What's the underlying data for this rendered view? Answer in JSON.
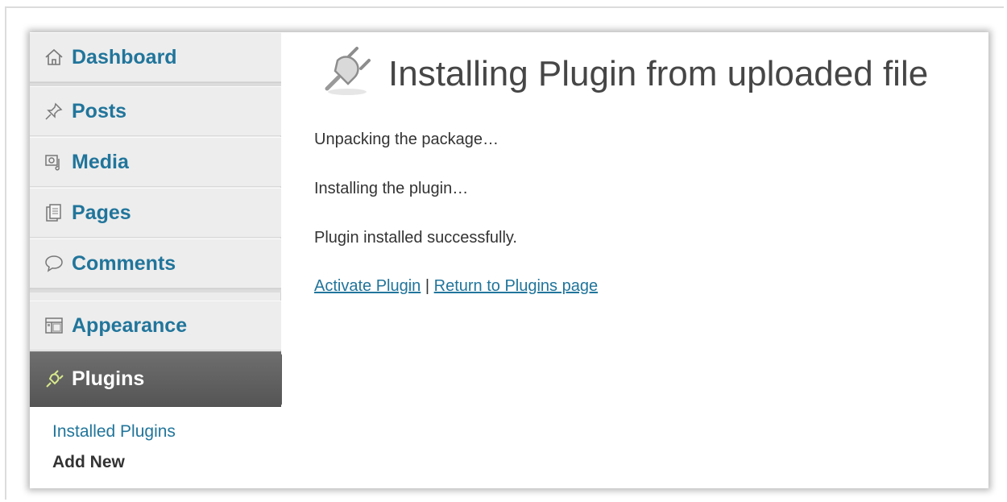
{
  "sidebar": {
    "items": [
      {
        "label": "Dashboard",
        "icon": "home-icon"
      },
      {
        "label": "Posts",
        "icon": "pushpin-icon"
      },
      {
        "label": "Media",
        "icon": "media-icon"
      },
      {
        "label": "Pages",
        "icon": "pages-icon"
      },
      {
        "label": "Comments",
        "icon": "comment-icon"
      },
      {
        "label": "Appearance",
        "icon": "appearance-icon"
      },
      {
        "label": "Plugins",
        "icon": "plug-icon"
      }
    ],
    "submenu": [
      {
        "label": "Installed Plugins"
      },
      {
        "label": "Add New"
      }
    ]
  },
  "main": {
    "title": "Installing Plugin from uploaded file",
    "messages": [
      "Unpacking the package…",
      "Installing the plugin…",
      "Plugin installed successfully."
    ],
    "activate_link": "Activate Plugin",
    "separator": "|",
    "return_link": "Return to Plugins page"
  },
  "colors": {
    "link": "#21759b",
    "active_bg": "#5e5e5e",
    "sidebar_bg": "#ededed"
  }
}
